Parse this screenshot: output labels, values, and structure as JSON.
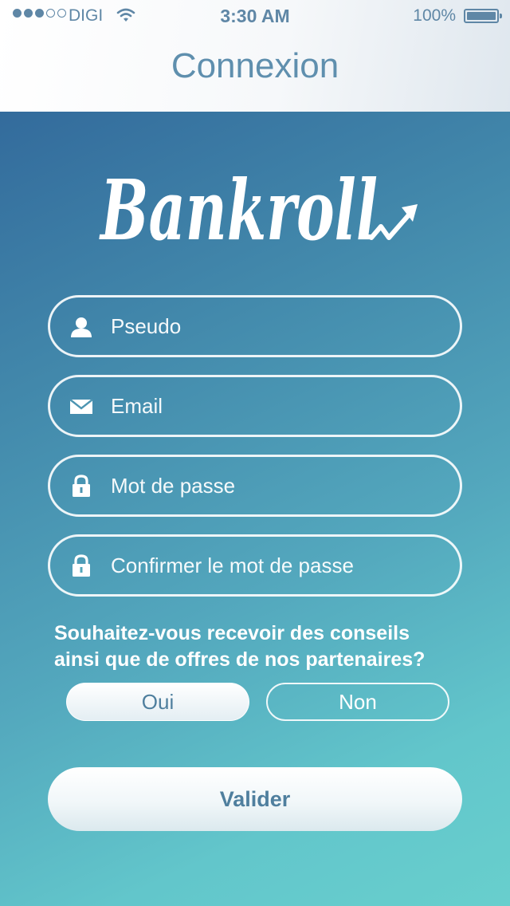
{
  "status_bar": {
    "carrier": "DIGI",
    "time": "3:30 AM",
    "battery": "100%"
  },
  "header": {
    "title": "Connexion"
  },
  "logo": {
    "text": "Bankroll"
  },
  "form": {
    "username": {
      "placeholder": "Pseudo",
      "value": ""
    },
    "email": {
      "placeholder": "Email",
      "value": ""
    },
    "password": {
      "placeholder": "Mot de passe",
      "value": ""
    },
    "confirm_password": {
      "placeholder": "Confirmer le mot de passe",
      "value": ""
    }
  },
  "newsletter": {
    "question_line1": "Souhaitez-vous recevoir des conseils",
    "question_line2": "ainsi que de offres de nos partenaires?",
    "yes_label": "Oui",
    "no_label": "Non",
    "selected": "Oui"
  },
  "submit_label": "Valider",
  "colors": {
    "accent": "#5f8fae",
    "gradient_top": "#336b9c",
    "gradient_bottom": "#68cfcd",
    "text_on_gradient": "#ffffff"
  },
  "icons": [
    "signal-dots",
    "wifi-icon",
    "battery-icon",
    "user-icon",
    "mail-icon",
    "lock-icon",
    "trend-arrow"
  ]
}
